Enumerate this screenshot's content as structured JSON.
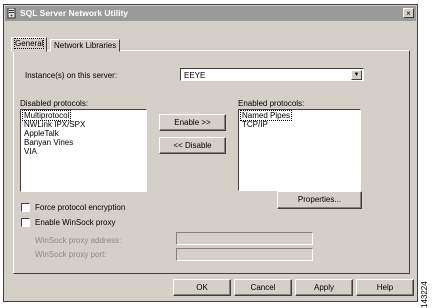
{
  "window": {
    "title": "SQL Server Network Utility",
    "close_label": "×"
  },
  "tabs": [
    {
      "label": "General",
      "active": true
    },
    {
      "label": "Network Libraries",
      "active": false
    }
  ],
  "instance": {
    "label": "Instance(s) on this server:",
    "value": "EEYE"
  },
  "disabled_protocols": {
    "label": "Disabled protocols:",
    "items": [
      "Multiprotocol",
      "NWLink IPX/SPX",
      "AppleTalk",
      "Banyan Vines",
      "VIA"
    ]
  },
  "enabled_protocols": {
    "label": "Enabled protocols:",
    "items": [
      "Named Pipes",
      "TCP/IP"
    ]
  },
  "buttons": {
    "enable": "Enable >>",
    "disable": "<< Disable",
    "properties": "Properties..."
  },
  "options": {
    "force_encryption": "Force protocol encryption",
    "enable_winsock": "Enable WinSock proxy",
    "winsock_address": "WinSock proxy address:",
    "winsock_port": "WinSock proxy port:"
  },
  "footer": {
    "ok": "OK",
    "cancel": "Cancel",
    "apply": "Apply",
    "help": "Help"
  },
  "figure_id": "143224"
}
